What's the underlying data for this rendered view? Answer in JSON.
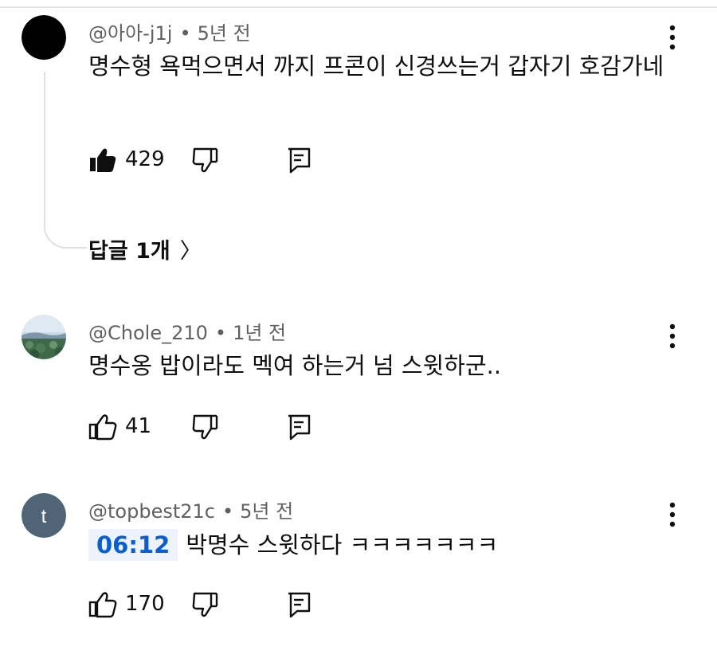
{
  "comments": [
    {
      "author": "@아아-j1j",
      "separator": "•",
      "time": "5년 전",
      "text": "명수형 욕먹으면서 까지 프콘이 신경쓰는거 갑자기 호감가네",
      "likes": "429",
      "liked": true,
      "avatar": {
        "type": "solid",
        "color": "#000000"
      },
      "replies_label": "답글 1개",
      "replies_chevron": "〉"
    },
    {
      "author": "@Chole_210",
      "separator": "•",
      "time": "1년 전",
      "text": "명수옹 밥이라도 멕여 하는거 넘 스윗하군..",
      "likes": "41",
      "liked": false,
      "avatar": {
        "type": "landscape-photo"
      }
    },
    {
      "author": "@topbest21c",
      "separator": "•",
      "time": "5년 전",
      "timestamp": "06:12",
      "text": "박명수 스윗하다 ㅋㅋㅋㅋㅋㅋㅋ",
      "likes": "170",
      "liked": false,
      "avatar": {
        "type": "letter",
        "letter": "t",
        "color": "#4f6477"
      }
    }
  ],
  "icons": {
    "like": "thumbs-up-icon",
    "dislike": "thumbs-down-icon",
    "reply": "reply-icon",
    "menu": "more-vert-icon",
    "chevron": "chevron-right-icon"
  },
  "colors": {
    "timestamp_link": "#065fd4",
    "timestamp_bg": "#eef3fb",
    "meta_text": "#606060"
  }
}
